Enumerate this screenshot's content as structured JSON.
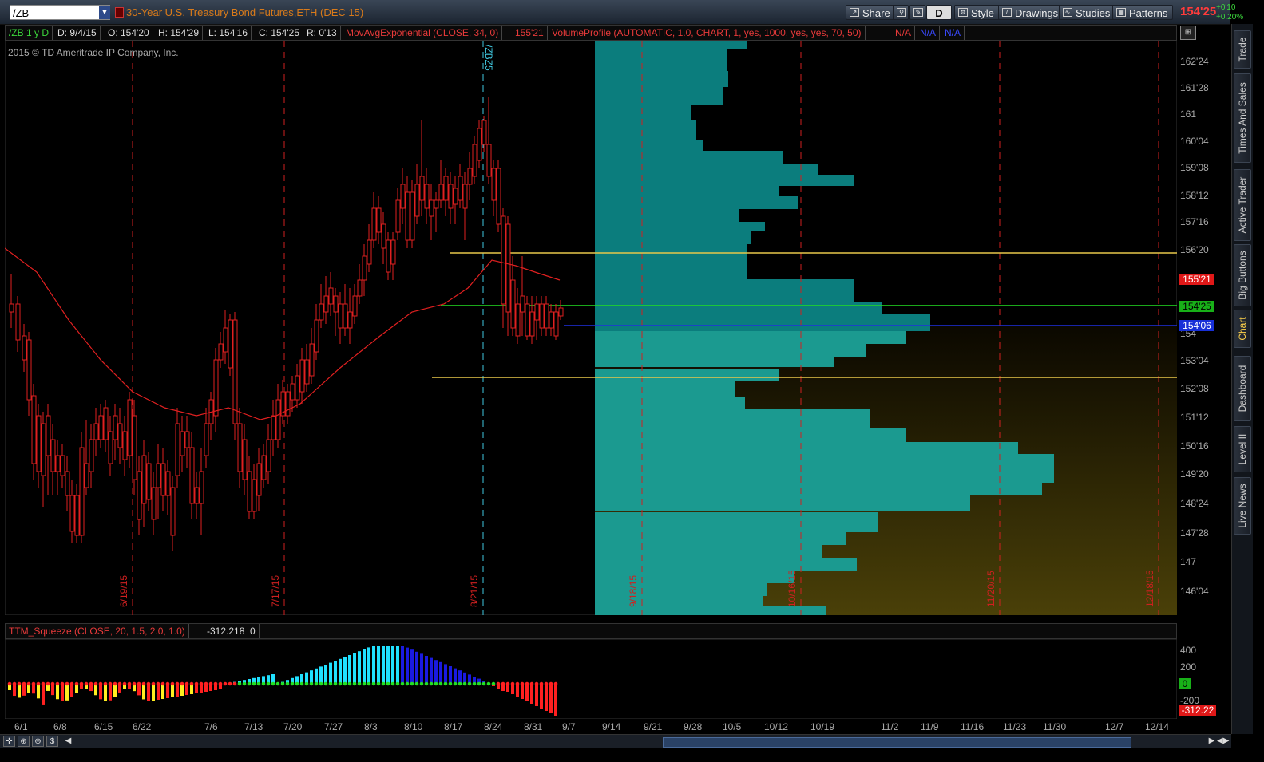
{
  "header": {
    "symbol": "/ZB",
    "title": "30-Year U.S. Treasury Bond Futures,ETH (DEC 15)",
    "buttons": [
      {
        "label": "Share",
        "icon": "share-icon"
      },
      {
        "label": "",
        "icon": "link-icon"
      },
      {
        "label": "",
        "icon": "wrench-icon"
      },
      {
        "label": "D",
        "icon": "aggregation-icon"
      },
      {
        "label": "Style",
        "icon": "style-icon"
      },
      {
        "label": "Drawings",
        "icon": "drawings-icon"
      },
      {
        "label": "Studies",
        "icon": "studies-icon"
      },
      {
        "label": "Patterns",
        "icon": "patterns-icon"
      }
    ],
    "last_price": "154'25",
    "net_change": "+0'10",
    "pct_change": "+0.20%"
  },
  "info_bar": {
    "period": "/ZB 1 y D",
    "date": "D: 9/4/15",
    "open": "O: 154'20",
    "high": "H: 154'29",
    "low": "L: 154'16",
    "close": "C: 154'25",
    "range": "R: 0'13",
    "ema_label": "MovAvgExponential (CLOSE, 34, 0)",
    "ema_value": "155'21",
    "vp_label": "VolumeProfile (AUTOMATIC, 1.0, CHART, 1, yes, 1000, yes, yes, 70, 50)",
    "na1": "N/A",
    "na2": "N/A",
    "na3": "N/A"
  },
  "copyright": "2015 © TD Ameritrade IP Company, Inc.",
  "price_axis": {
    "ticks": [
      "162'24",
      "161'28",
      "161",
      "160'04",
      "159'08",
      "158'12",
      "157'16",
      "156'20",
      "154",
      "153'04",
      "152'08",
      "151'12",
      "150'16",
      "149'20",
      "148'24",
      "147'28",
      "147",
      "146'04"
    ],
    "badge_ema": "155'21",
    "badge_last": "154'25",
    "badge_blue": "154'06"
  },
  "date_markers": [
    "6/19/15",
    "7/17/15",
    "8/21/15",
    "9/18/15",
    "10/16/15",
    "11/20/15",
    "12/18/15"
  ],
  "contract_marker": "/ZBZ5",
  "lower": {
    "study_label": "TTM_Squeeze (CLOSE, 20, 1.5, 2.0, 1.0)",
    "study_value": "-312.218",
    "study_value2": "0",
    "axis_ticks": [
      "400",
      "200",
      "0",
      "-200"
    ],
    "badge_value": "-312.22"
  },
  "x_axis": [
    "6/1",
    "6/8",
    "6/15",
    "6/22",
    "7/6",
    "7/13",
    "7/20",
    "7/27",
    "8/3",
    "8/10",
    "8/17",
    "8/24",
    "8/31",
    "9/7",
    "9/14",
    "9/21",
    "9/28",
    "10/5",
    "10/12",
    "10/19",
    "11/2",
    "11/9",
    "11/16",
    "11/23",
    "11/30",
    "12/7",
    "12/14"
  ],
  "sidebar_tabs": [
    "Trade",
    "Times And Sales",
    "Active Trader",
    "Big Buttons",
    "Chart",
    "Dashboard",
    "Level II",
    "Live News"
  ],
  "colors": {
    "up": "#22c022",
    "down": "#e02020",
    "ema": "#e02020",
    "vp": "#0e8a8a",
    "value_area": "#e8c84a",
    "poc": "#22e022"
  }
}
